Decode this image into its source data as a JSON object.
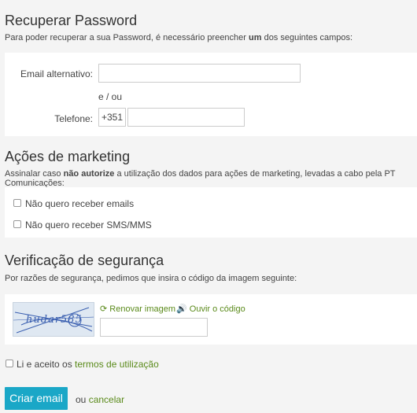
{
  "recover": {
    "title": "Recuperar Password",
    "desc_pre": "Para poder recuperar a sua Password, é necessário preencher ",
    "desc_bold": "um",
    "desc_post": " dos seguintes campos:",
    "email_label": "Email alternativo:",
    "or_text": "e / ou",
    "phone_label": "Telefone:",
    "phone_prefix": "+351"
  },
  "marketing": {
    "title": "Ações de marketing",
    "desc_pre": "Assinalar caso ",
    "desc_bold": "não autorize",
    "desc_post": " a utilização dos dados para ações de marketing, levadas a cabo pela PT Comunicações:",
    "opt_emails": "Não quero receber emails",
    "opt_sms": "Não quero receber SMS/MMS"
  },
  "security": {
    "title": "Verificação de segurança",
    "desc": "Por razões de segurança, pedimos que insira o código da imagem seguinte:",
    "captcha_text": "hudar585",
    "renew": "Renovar imagem",
    "listen": "Ouvir o código"
  },
  "terms": {
    "pre": "Li e aceito os ",
    "link": "termos de utilização"
  },
  "actions": {
    "submit": "Criar email",
    "or": "ou",
    "cancel": "cancelar"
  },
  "colors": {
    "accent": "#1aa7c7",
    "link": "#5a8a1a"
  }
}
